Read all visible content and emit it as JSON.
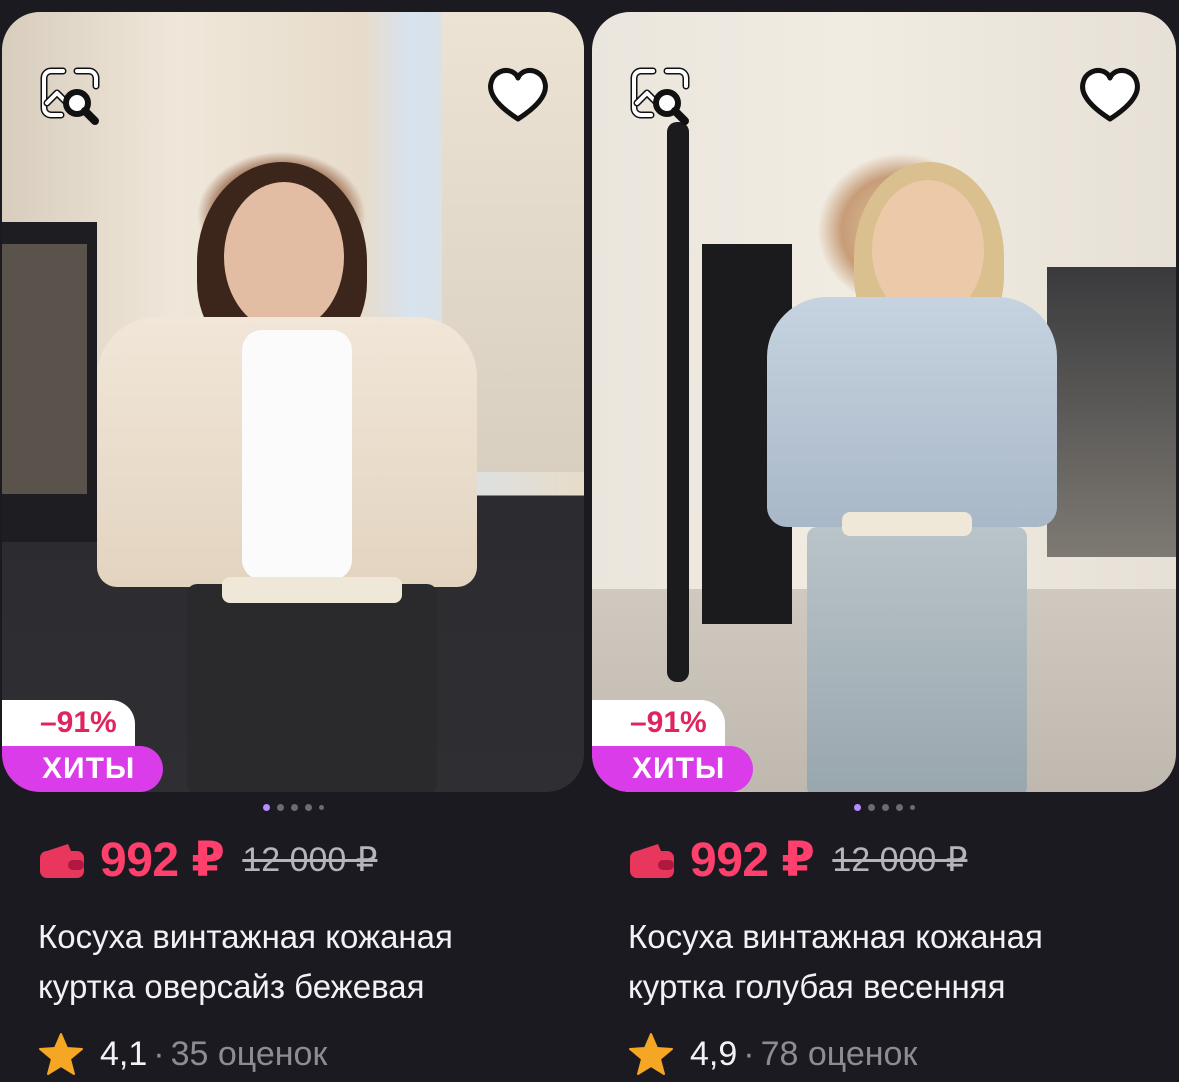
{
  "products": [
    {
      "discount_badge": "–91%",
      "label_badge": "ХИТЫ",
      "price": "992 ₽",
      "old_price": "12 000 ₽",
      "title_line1": "Косуха винтажная кожаная",
      "title_line2": "куртка оверсайз бежевая",
      "rating": "4,1",
      "rating_separator": "·",
      "reviews": "35 оценок",
      "photo_index": 1,
      "photo_count": 5
    },
    {
      "discount_badge": "–91%",
      "label_badge": "ХИТЫ",
      "price": "992 ₽",
      "old_price": "12 000 ₽",
      "title_line1": "Косуха винтажная кожаная",
      "title_line2": "куртка голубая весенняя",
      "rating": "4,9",
      "rating_separator": "·",
      "reviews": "78 оценок",
      "photo_index": 1,
      "photo_count": 5
    }
  ],
  "icons": {
    "search_by_photo": "image-search-icon",
    "favorite": "heart-icon",
    "wallet": "wallet-icon",
    "rating": "star-icon"
  },
  "colors": {
    "price": "#ff3f6c",
    "discount_text": "#e0245e",
    "hits_badge": "#d93ce8",
    "star": "#f5a623",
    "background": "#1c1a21"
  }
}
